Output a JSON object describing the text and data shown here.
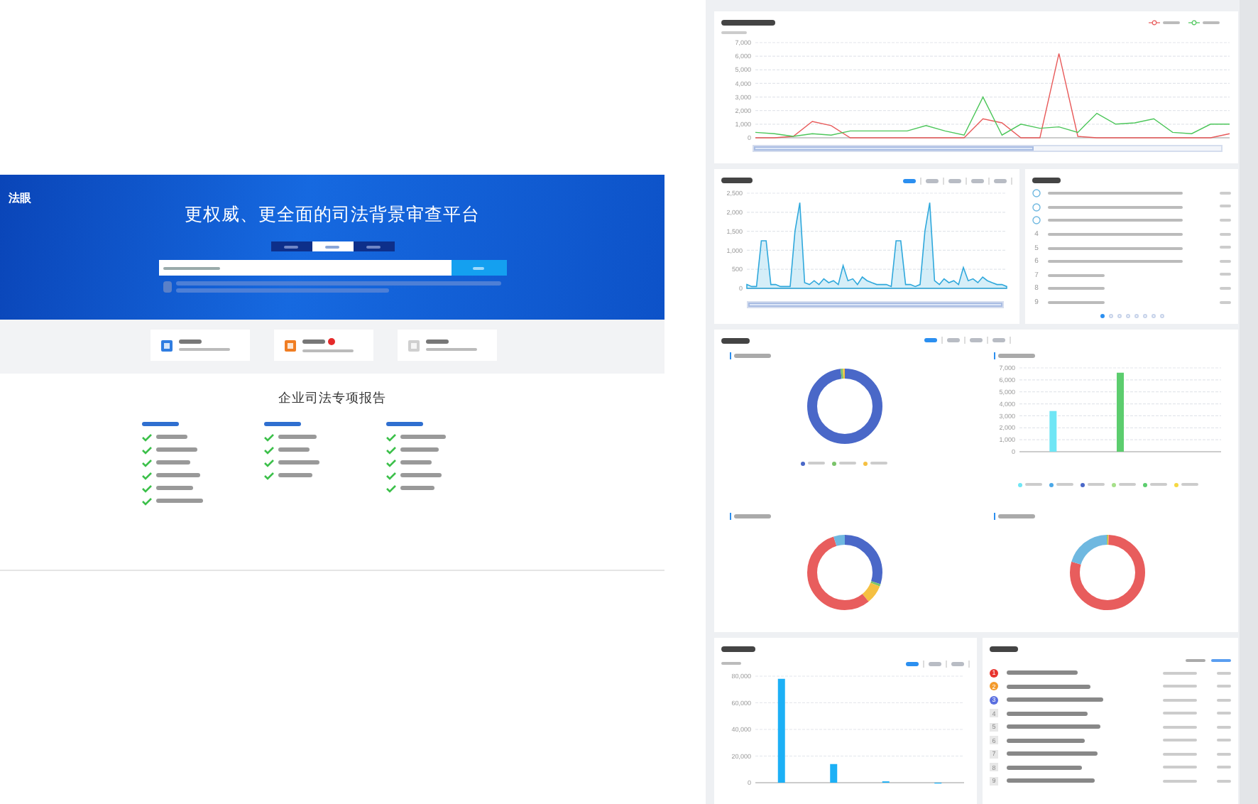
{
  "left": {
    "logo": "法眼",
    "headline": "更权威、更全面的司法背景审查平台",
    "search_tabs": [
      {
        "selected": false
      },
      {
        "selected": true
      },
      {
        "selected": false
      }
    ],
    "cards": [
      {
        "color": "#2f7de1",
        "badge": false
      },
      {
        "color": "#f07d22",
        "badge": true
      },
      {
        "color": "#cfcfcf",
        "badge": false
      }
    ],
    "report": {
      "title": "企业司法专项报告",
      "columns": [
        {
          "items": [
            {
              "checked": true
            },
            {
              "checked": true
            },
            {
              "checked": true
            },
            {
              "checked": true
            },
            {
              "checked": true
            },
            {
              "checked": true
            }
          ]
        },
        {
          "items": [
            {
              "checked": true
            },
            {
              "checked": true
            },
            {
              "checked": true
            },
            {
              "checked": true
            }
          ]
        },
        {
          "items": [
            {
              "checked": true
            },
            {
              "checked": true
            },
            {
              "checked": true
            },
            {
              "checked": true
            },
            {
              "checked": true
            }
          ]
        }
      ]
    }
  },
  "trend": {
    "zoom": {
      "level": 0.6
    },
    "chart_data": {
      "type": "line",
      "grid": true,
      "ylim": [
        0,
        7000
      ],
      "yticks": [
        {
          "value": 0,
          "label": "0"
        },
        {
          "value": 1000,
          "label": "1,000"
        },
        {
          "value": 2000,
          "label": "2,000"
        },
        {
          "value": 3000,
          "label": "3,000"
        },
        {
          "value": 4000,
          "label": "4,000"
        },
        {
          "value": 5000,
          "label": "5,000"
        },
        {
          "value": 6000,
          "label": "6,000"
        },
        {
          "value": 7000,
          "label": "7,000"
        }
      ],
      "series": [
        {
          "color": "#e85a5a",
          "values": [
            0,
            0,
            100,
            1200,
            900,
            0,
            0,
            0,
            0,
            0,
            0,
            0,
            1400,
            1100,
            0,
            0,
            6200,
            100,
            0,
            0,
            0,
            0,
            0,
            0,
            0,
            300
          ]
        },
        {
          "color": "#4cc65a",
          "values": [
            400,
            300,
            100,
            300,
            200,
            500,
            500,
            500,
            500,
            900,
            500,
            200,
            3000,
            200,
            1000,
            700,
            800,
            400,
            1800,
            1000,
            1100,
            1400,
            400,
            300,
            1000,
            1000
          ]
        }
      ]
    }
  },
  "cases": {
    "range_tabs": [
      {
        "selected": true
      },
      {
        "selected": false
      },
      {
        "selected": false
      },
      {
        "selected": false
      },
      {
        "selected": false
      }
    ],
    "zoom": {
      "level": 1
    },
    "chart_data": {
      "type": "area",
      "grid": true,
      "ylim": [
        0,
        2500
      ],
      "yticks": [
        {
          "value": 0,
          "label": "0"
        },
        {
          "value": 500,
          "label": "500"
        },
        {
          "value": 1000,
          "label": "1,000"
        },
        {
          "value": 1500,
          "label": "1,500"
        },
        {
          "value": 2000,
          "label": "2,000"
        },
        {
          "value": 2500,
          "label": "2,500"
        }
      ],
      "series": [
        {
          "color": "#2fa8dc",
          "values": [
            100,
            50,
            50,
            1250,
            1250,
            100,
            100,
            50,
            50,
            50,
            1500,
            2250,
            150,
            100,
            200,
            100,
            250,
            150,
            200,
            100,
            600,
            200,
            250,
            100,
            300,
            200,
            150,
            100,
            100,
            100,
            50,
            1250,
            1250,
            100,
            100,
            50,
            100,
            1500,
            2250,
            200,
            100,
            250,
            150,
            200,
            100,
            550,
            200,
            250,
            150,
            300,
            200,
            150,
            100,
            100,
            50
          ]
        }
      ]
    }
  },
  "ranking": {
    "rows": [
      {
        "kind": "medal"
      },
      {
        "kind": "medal"
      },
      {
        "kind": "medal"
      },
      {
        "kind": "number",
        "rank": "4"
      },
      {
        "kind": "number",
        "rank": "5"
      },
      {
        "kind": "number",
        "rank": "6"
      },
      {
        "kind": "number",
        "rank": "7"
      },
      {
        "kind": "number",
        "rank": "8"
      },
      {
        "kind": "number",
        "rank": "9"
      }
    ],
    "pages": [
      {
        "selected": true
      },
      {
        "selected": false
      },
      {
        "selected": false
      },
      {
        "selected": false
      },
      {
        "selected": false
      },
      {
        "selected": false
      },
      {
        "selected": false
      },
      {
        "selected": false
      }
    ]
  },
  "analysis": {
    "tabs": [
      {
        "selected": true
      },
      {
        "selected": false
      },
      {
        "selected": false
      },
      {
        "selected": false
      }
    ],
    "chart_data": {
      "type": "bar",
      "grid": true,
      "ylim": [
        0,
        7000
      ],
      "yticks": [
        {
          "value": 0,
          "label": "0"
        },
        {
          "value": 1000,
          "label": "1,000"
        },
        {
          "value": 2000,
          "label": "2,000"
        },
        {
          "value": 3000,
          "label": "3,000"
        },
        {
          "value": 4000,
          "label": "4,000"
        },
        {
          "value": 5000,
          "label": "5,000"
        },
        {
          "value": 6000,
          "label": "6,000"
        },
        {
          "value": 7000,
          "label": "7,000"
        }
      ],
      "series": [
        {
          "color": "#6fe6f5",
          "values": [
            3400,
            null,
            null
          ]
        },
        {
          "color": "#5ccd6e",
          "values": [
            null,
            6600,
            null
          ]
        }
      ]
    }
  },
  "amount": {
    "tabs": [
      {
        "selected": true
      },
      {
        "selected": false
      },
      {
        "selected": false
      }
    ],
    "chart_data": {
      "type": "bar",
      "grid": true,
      "ylim": [
        0,
        80000
      ],
      "yticks": [
        {
          "value": 0,
          "label": "0"
        },
        {
          "value": 20000,
          "label": "20,000"
        },
        {
          "value": 40000,
          "label": "40,000"
        },
        {
          "value": 60000,
          "label": "60,000"
        },
        {
          "value": 80000,
          "label": "80,000"
        }
      ],
      "series": [
        {
          "color": "#1cb0f6",
          "values": [
            78000,
            14000,
            1000,
            0
          ]
        }
      ]
    }
  },
  "parties": {
    "rows": [
      {
        "kind": "badge",
        "rank": "1",
        "color": "#e8342e"
      },
      {
        "kind": "badge",
        "rank": "2",
        "color": "#f39a2b"
      },
      {
        "kind": "badge",
        "rank": "3",
        "color": "#5a6fe0"
      },
      {
        "kind": "number",
        "rank": "4"
      },
      {
        "kind": "number",
        "rank": "5"
      },
      {
        "kind": "number",
        "rank": "6"
      },
      {
        "kind": "number",
        "rank": "7"
      },
      {
        "kind": "number",
        "rank": "8"
      },
      {
        "kind": "number",
        "rank": "9"
      }
    ]
  }
}
